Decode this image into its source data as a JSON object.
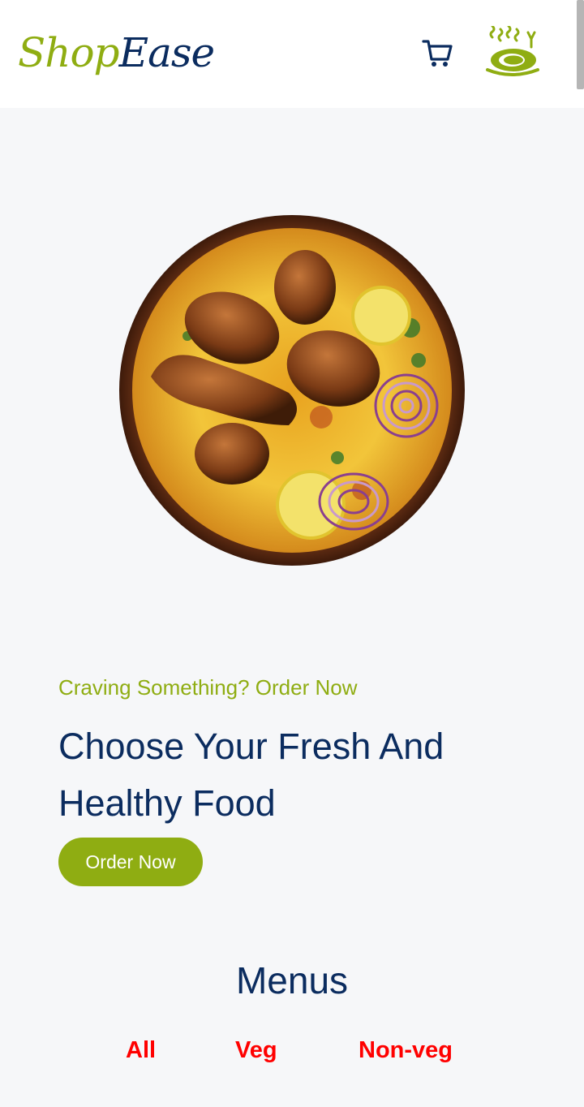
{
  "header": {
    "logo_part1": "Shop",
    "logo_part2": "Ease",
    "cart_icon": "shopping-cart-icon",
    "dish_icon": "hot-dish-icon"
  },
  "hero": {
    "image": "biryani-plate-image",
    "tagline": "Craving Something? Order Now",
    "headline": "Choose Your Fresh And Healthy Food",
    "order_button": "Order Now"
  },
  "menus": {
    "title": "Menus",
    "filters": [
      "All",
      "Veg",
      "Non-veg"
    ]
  },
  "colors": {
    "brand_green": "#8fad12",
    "brand_navy": "#0b2c5f",
    "filter_red": "#ff0000",
    "background": "#f6f7f9"
  }
}
